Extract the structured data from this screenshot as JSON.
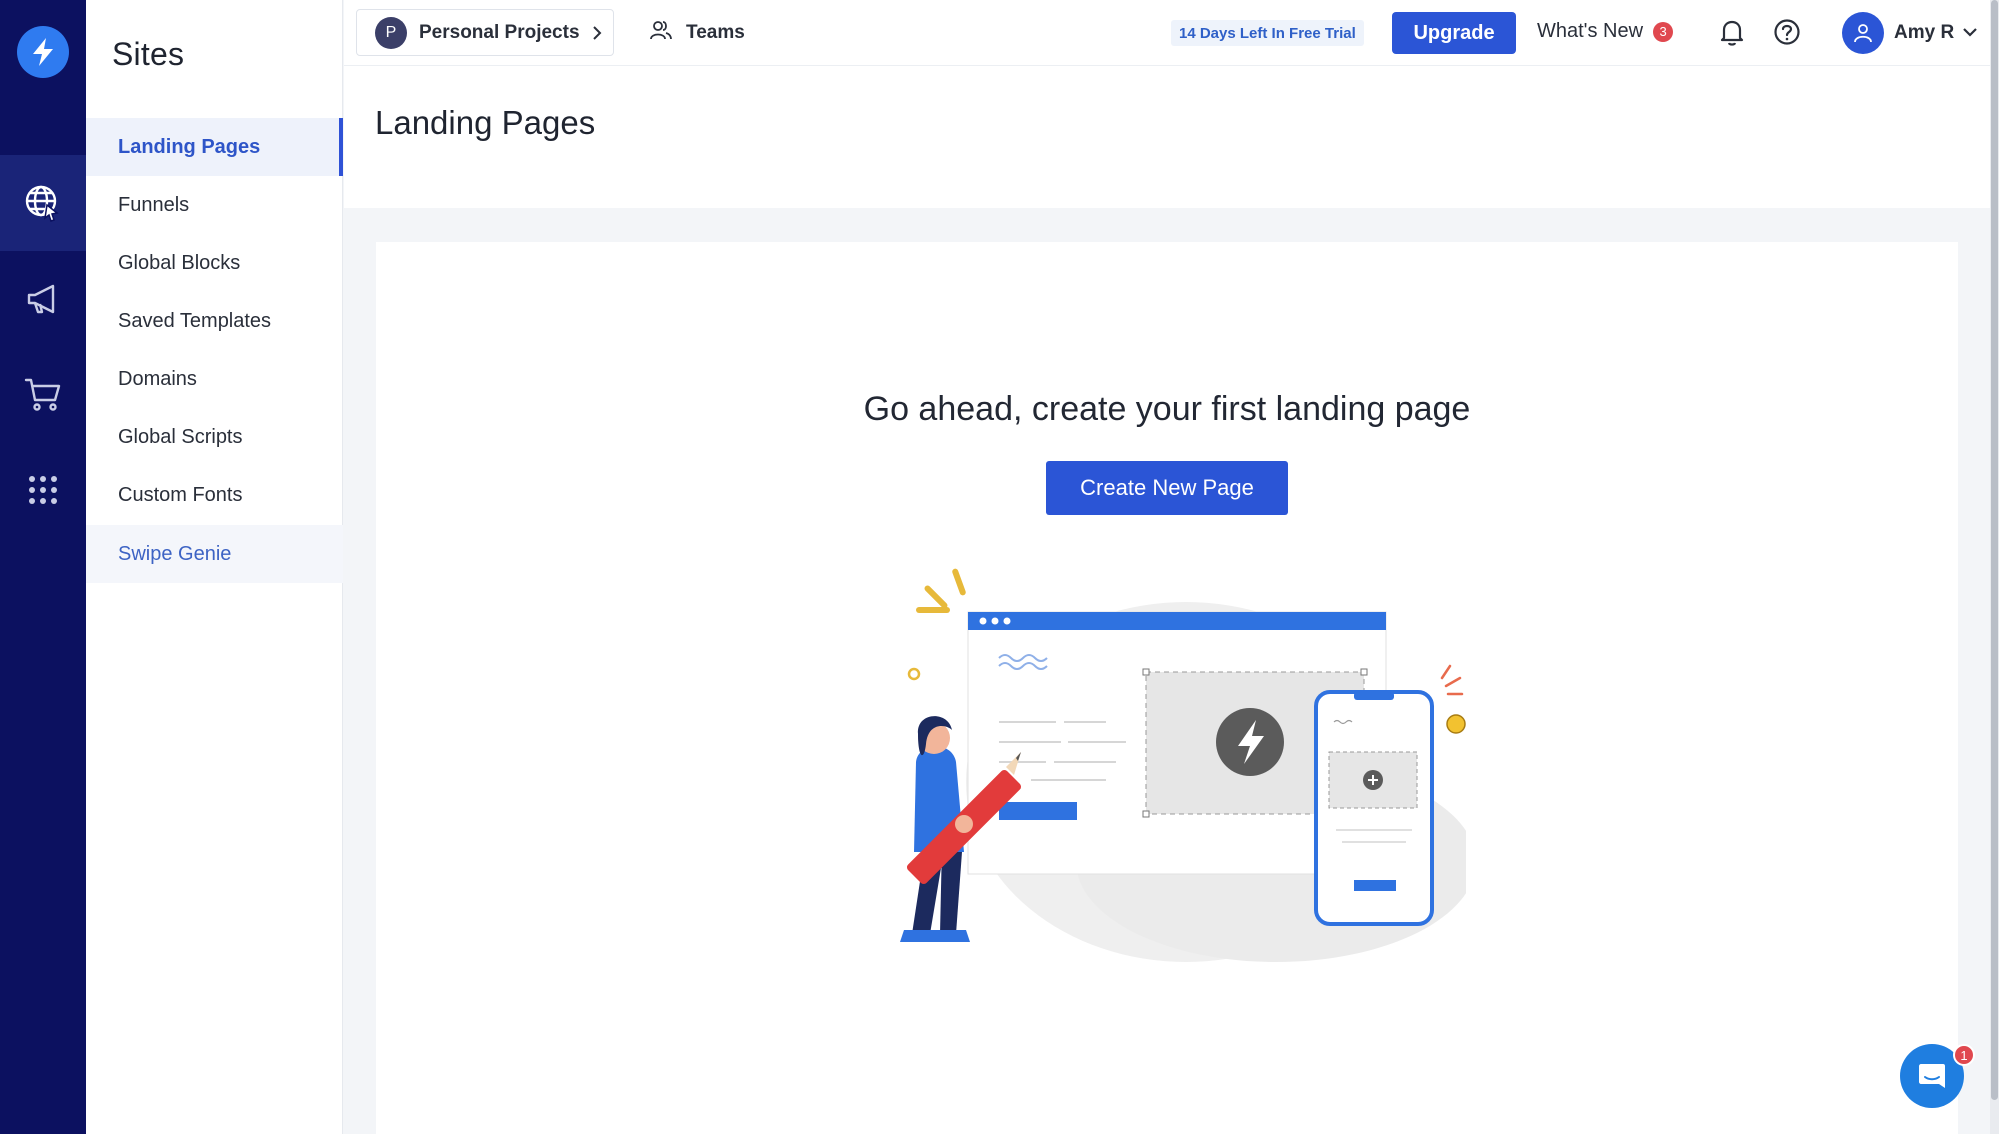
{
  "sidebar": {
    "title": "Sites",
    "items": [
      {
        "label": "Landing Pages"
      },
      {
        "label": "Funnels"
      },
      {
        "label": "Global Blocks"
      },
      {
        "label": "Saved Templates"
      },
      {
        "label": "Domains"
      },
      {
        "label": "Global Scripts"
      },
      {
        "label": "Custom Fonts"
      },
      {
        "label": "Swipe Genie"
      }
    ]
  },
  "rail": {
    "icons": [
      "bolt-logo-icon",
      "globe-cursor-icon",
      "megaphone-icon",
      "cart-icon",
      "apps-grid-icon"
    ]
  },
  "topbar": {
    "project_initial": "P",
    "project_name": "Personal Projects",
    "teams_label": "Teams",
    "trial_text": "14 Days Left In Free Trial",
    "upgrade_label": "Upgrade",
    "whats_new_label": "What's New",
    "whats_new_count": "3",
    "user_name": "Amy R"
  },
  "main": {
    "page_title": "Landing Pages",
    "empty_title": "Go ahead, create your first landing page",
    "create_button": "Create New Page"
  },
  "chat": {
    "badge_count": "1"
  },
  "colors": {
    "rail_bg": "#0c1160",
    "accent": "#2b55d6",
    "badge": "#e0484f"
  }
}
